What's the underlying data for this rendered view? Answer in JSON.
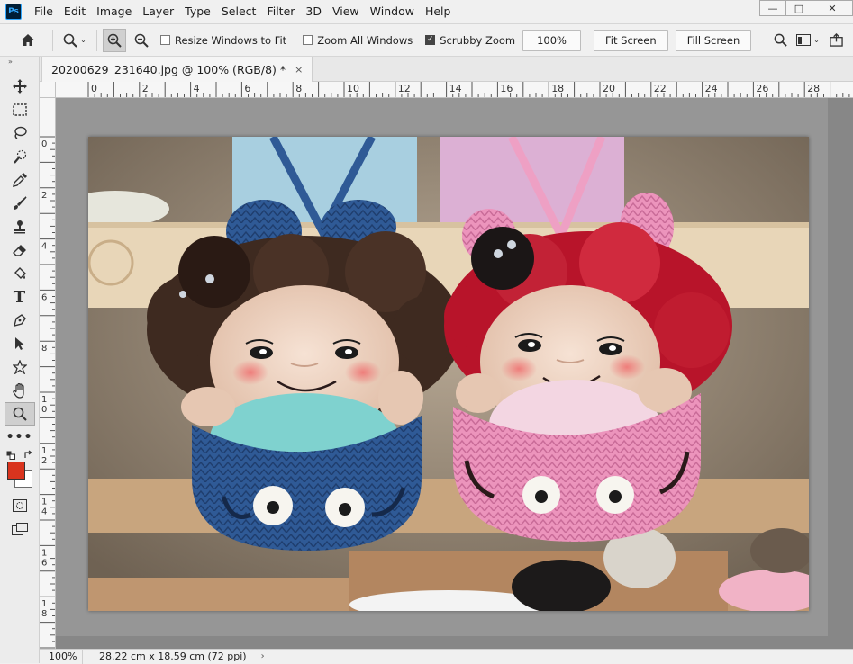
{
  "app": {
    "logo": "Ps"
  },
  "menu": [
    "File",
    "Edit",
    "Image",
    "Layer",
    "Type",
    "Select",
    "Filter",
    "3D",
    "View",
    "Window",
    "Help"
  ],
  "window_controls": {
    "minimize": "—",
    "maximize": "□",
    "close": "✕"
  },
  "options": {
    "resize_windows": {
      "label": "Resize Windows to Fit",
      "checked": false
    },
    "zoom_all": {
      "label": "Zoom All Windows",
      "checked": false
    },
    "scrubby": {
      "label": "Scrubby Zoom",
      "checked": true
    },
    "zoom_value": "100%",
    "fit_screen": "Fit Screen",
    "fill_screen": "Fill Screen"
  },
  "icons": {
    "home": "home-icon",
    "zoom_tool": "zoom-icon",
    "zoom_in": "zoom-in-icon",
    "zoom_out": "zoom-out-icon",
    "search": "search-icon",
    "workspace": "workspace-icon",
    "share": "share-icon"
  },
  "tools": [
    "move-tool",
    "marquee-tool",
    "lasso-tool",
    "quick-select-tool",
    "eyedropper-tool",
    "brush-tool",
    "stamp-tool",
    "eraser-tool",
    "paint-bucket-tool",
    "type-tool",
    "pen-tool",
    "path-select-tool",
    "shape-tool",
    "hand-tool",
    "zoom-tool",
    "more-tools"
  ],
  "colors": {
    "foreground": "#d9341e",
    "background": "#ffffff",
    "canvas": "#969696",
    "pasteboard": "#878787"
  },
  "document": {
    "tab_title": "20200629_231640.jpg @ 100% (RGB/8) *",
    "close": "×"
  },
  "rulers": {
    "horizontal": [
      "0",
      "2",
      "4",
      "6",
      "8",
      "10",
      "12",
      "14",
      "16",
      "18",
      "20",
      "22",
      "24",
      "26",
      "28"
    ],
    "vertical": [
      "0",
      "2",
      "4",
      "6",
      "8",
      "1 0",
      "1 2",
      "1 4",
      "1 6",
      "1 8"
    ]
  },
  "status": {
    "zoom": "100%",
    "size": "28.22 cm x 18.59 cm (72 ppi)",
    "arrow": "›"
  }
}
